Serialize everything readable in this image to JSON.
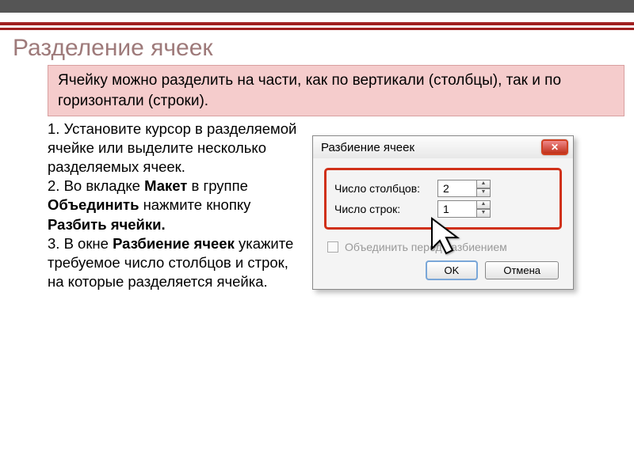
{
  "title": "Разделение ячеек",
  "pinkbox": "Ячейку можно разделить на части, как по вертикали (столбцы), так и по горизонтали (строки).",
  "steps": {
    "s1": "1. Установите курсор в разделяемой ячейке или выделите несколько разделяемых ячеек.",
    "s2a": "2. Во вкладке ",
    "s2b": "Макет",
    "s2c": " в группе ",
    "s2d": "Объединить",
    "s2e": " нажмите кнопку ",
    "s2f": "Разбить ячейки.",
    "s3a": "3. В окне ",
    "s3b": "Разбиение ячеек",
    "s3c": " укажите требуемое число столбцов и строк, на которые разделяется ячейка."
  },
  "dialog": {
    "title": "Разбиение ячеек",
    "cols_label": "Число столбцов:",
    "cols_value": "2",
    "rows_label": "Число строк:",
    "rows_value": "1",
    "checkbox_label": "Объединить перед разбиением",
    "ok": "OK",
    "cancel": "Отмена"
  }
}
